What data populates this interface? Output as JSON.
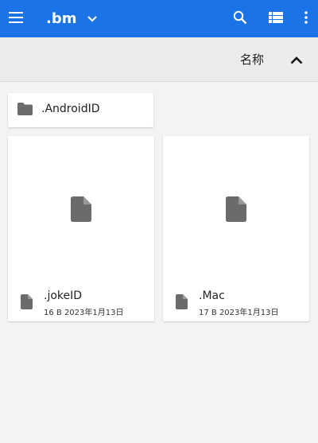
{
  "app_bar": {
    "title": ".bm",
    "background": "#1b73e8",
    "menu_icon": "hamburger-menu-icon",
    "dropdown_icon": "chevron-down-icon",
    "search_icon": "search-icon",
    "view_icon": "list-view-icon",
    "more_icon": "more-vert-icon"
  },
  "sort_bar": {
    "label": "名称",
    "arrow_icon": "chevron-up-icon"
  },
  "folders": [
    {
      "name": ".AndroidID",
      "icon": "folder-icon"
    }
  ],
  "files": [
    {
      "name": ".jokeID",
      "size": "16 B",
      "date": "2023年1月13日",
      "meta": "16 B 2023年1月13日",
      "icon": "file-icon"
    },
    {
      "name": ".Mac",
      "size": "17 B",
      "date": "2023年1月13日",
      "meta": "17 B 2023年1月13日",
      "icon": "file-icon"
    }
  ]
}
